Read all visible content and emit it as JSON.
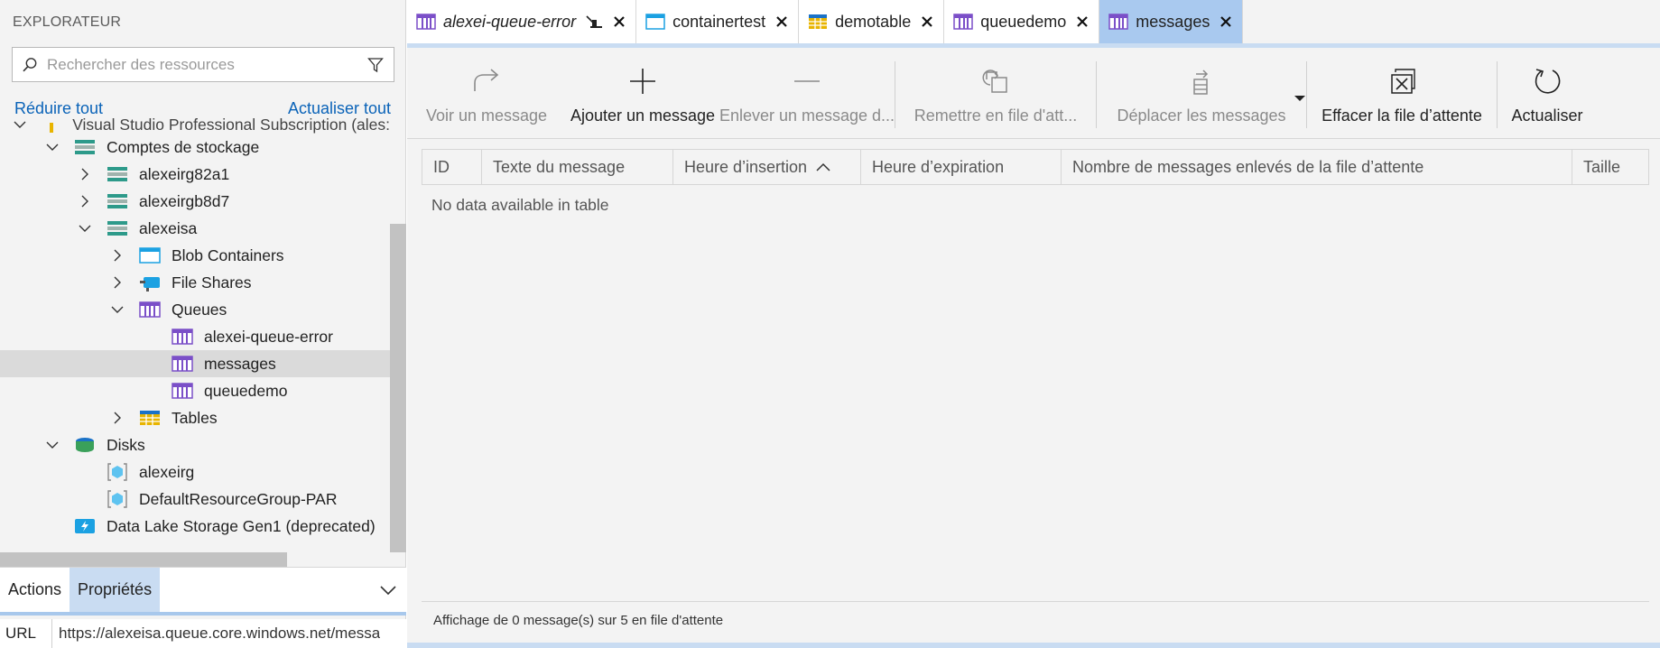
{
  "explorer": {
    "title": "EXPLORATEUR",
    "search_placeholder": "Rechercher des ressources",
    "collapse_all": "Réduire tout",
    "refresh_all": "Actualiser tout",
    "tree": [
      {
        "label": "Visual Studio Professional Subscription (ales:",
        "icon": "key-icon",
        "expanded": true
      },
      {
        "label": "Comptes de stockage",
        "icon": "storage-accounts-icon",
        "expanded": true
      },
      {
        "label": "alexeirg82a1",
        "icon": "storage-account-icon",
        "expanded": false
      },
      {
        "label": "alexeirgb8d7",
        "icon": "storage-account-icon",
        "expanded": false
      },
      {
        "label": "alexeisa",
        "icon": "storage-account-icon",
        "expanded": true
      },
      {
        "label": "Blob Containers",
        "icon": "blob-container-icon",
        "expanded": false
      },
      {
        "label": "File Shares",
        "icon": "file-share-icon",
        "expanded": false
      },
      {
        "label": "Queues",
        "icon": "queue-icon",
        "expanded": true
      },
      {
        "label": "alexei-queue-error",
        "icon": "queue-icon"
      },
      {
        "label": "messages",
        "icon": "queue-icon",
        "selected": true
      },
      {
        "label": "queuedemo",
        "icon": "queue-icon"
      },
      {
        "label": "Tables",
        "icon": "table-icon",
        "expanded": false
      },
      {
        "label": "Disks",
        "icon": "disks-icon",
        "expanded": true
      },
      {
        "label": "alexeirg",
        "icon": "resource-group-icon"
      },
      {
        "label": "DefaultResourceGroup-PAR",
        "icon": "resource-group-icon"
      },
      {
        "label": "Data Lake Storage Gen1 (deprecated)",
        "icon": "data-lake-icon"
      }
    ],
    "bottom_tabs": [
      "Actions",
      "Propriétés"
    ],
    "properties": {
      "key": "URL",
      "value": "https://alexeisa.queue.core.windows.net/messa"
    }
  },
  "tabs": [
    {
      "label": "alexei-queue-error",
      "icon": "queue-icon",
      "italic": true,
      "pinned": true
    },
    {
      "label": "containertest",
      "icon": "blob-container-icon"
    },
    {
      "label": "demotable",
      "icon": "table-icon"
    },
    {
      "label": "queuedemo",
      "icon": "queue-icon"
    },
    {
      "label": "messages",
      "icon": "queue-icon",
      "active": true
    }
  ],
  "toolbar": {
    "view_message": "Voir un message",
    "add_message": "Ajouter un message",
    "dequeue_message": "Enlever un message d...",
    "requeue": "Remettre en file d'att...",
    "move_messages": "Déplacer les messages",
    "clear_queue": "Effacer la file d’attente",
    "refresh": "Actualiser"
  },
  "grid": {
    "columns": [
      "ID",
      "Texte du message",
      "Heure d’insertion",
      "Heure d’expiration",
      "Nombre de messages enlevés de la file d’attente",
      "Taille"
    ],
    "empty_text": "No data available in table"
  },
  "status": "Affichage de 0 message(s) sur 5 en file d'attente",
  "colors": {
    "accent": "#a9c9ef",
    "link": "#0a63b8",
    "queue_icon": "#7b4fc8",
    "storage_icon": "#2d9a8a",
    "blob_icon": "#1ba1e2"
  }
}
